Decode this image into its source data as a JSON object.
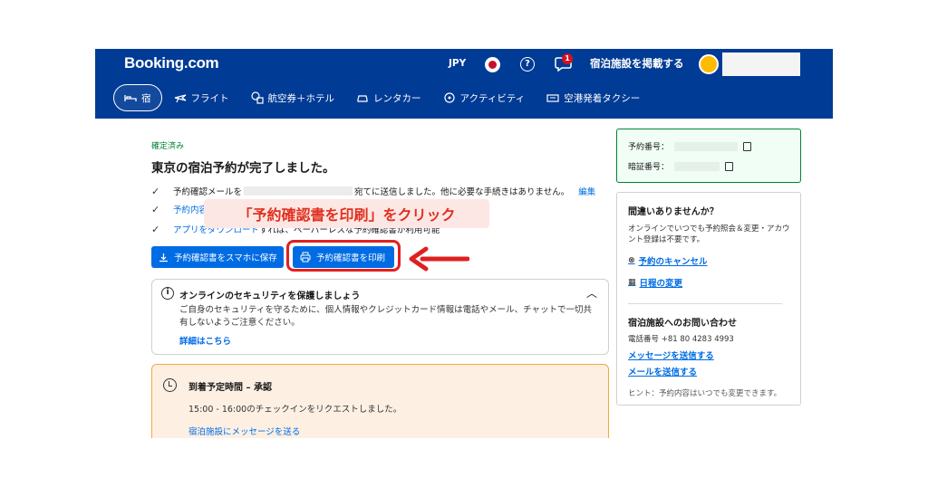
{
  "header": {
    "logo": "Booking.com",
    "currency": "JPY",
    "notification_count": "1",
    "list_property": "宿泊施設を掲載する"
  },
  "nav": {
    "items": [
      {
        "label": "宿",
        "icon": "bed-icon"
      },
      {
        "label": "フライト",
        "icon": "plane-icon"
      },
      {
        "label": "航空券＋ホテル",
        "icon": "plane-hotel-icon"
      },
      {
        "label": "レンタカー",
        "icon": "car-icon"
      },
      {
        "label": "アクティビティ",
        "icon": "attraction-icon"
      },
      {
        "label": "空港発着タクシー",
        "icon": "taxi-icon"
      }
    ]
  },
  "main": {
    "status": "確定済み",
    "title": "東京の宿泊予約が完了しました。",
    "line1_prefix": "予約確認メールを",
    "line1_suffix": "宛てに送信しました。他に必要な手続きはありません。",
    "line1_link": "編集",
    "line2_link": "予約内容",
    "line3_link": "アプリをダウンロード",
    "line3_text": "すれば、ペーパーレスな予約確認書が利用可能",
    "save_button": "予約確認書をスマホに保存",
    "print_button": "予約確認書を印刷",
    "callout": "「予約確認書を印刷」をクリック",
    "security": {
      "title": "オンラインのセキュリティを保護しましょう",
      "body": "ご自身のセキュリティを守るために、個人情報やクレジットカード情報は電話やメール、チャットで一切共有しないようご注意ください。",
      "link": "詳細はこちら"
    },
    "arrival": {
      "title": "到着予定時間 – 承認",
      "body": "15:00 - 16:00のチェックインをリクエストしました。",
      "link": "宿泊施設にメッセージを送る"
    }
  },
  "sidebar": {
    "booking_number_label": "予約番号：",
    "pin_label": "暗証番号：",
    "help_title": "間違いありませんか？",
    "help_text": "オンラインでいつでも予約照会＆変更・アカウント登録は不要です。",
    "cancel_link": "予約のキャンセル",
    "change_link": "日程の変更",
    "contact_title": "宿泊施設へのお問い合わせ",
    "phone": "電話番号 +81 80 4283 4993",
    "message_link": "メッセージを送信する",
    "email_link": "メールを送信する",
    "hint": "ヒント：予約内容はいつでも変更できます。"
  },
  "colors": {
    "brand": "#003b95",
    "link": "#006ce4",
    "accent_red": "#e02020",
    "success": "#008234"
  }
}
